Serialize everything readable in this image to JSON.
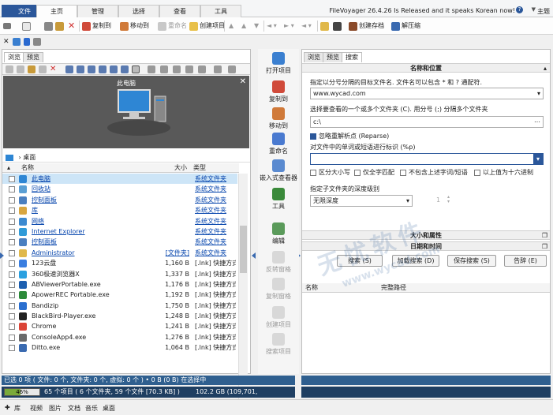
{
  "ribbon": {
    "tabs": [
      "文件",
      "主页",
      "管理",
      "选择",
      "查看",
      "工具"
    ],
    "active_tab": "主页",
    "promo": "FileVoyager 26.4.26 Is Released and it speaks Korean now!",
    "theme": "主题",
    "buttons": {
      "copy_to": "复制到",
      "move_to": "移动到",
      "rename": "重命名",
      "create_item": "创建项目",
      "create_archive": "创建存档",
      "extract": "解压缩"
    }
  },
  "left_pane": {
    "tabs": [
      "浏览",
      "预览"
    ],
    "active_tab": "浏览",
    "preview_title": "此电脑",
    "breadcrumb": "桌面",
    "columns": {
      "name": "名称",
      "size": "大小",
      "type": "类型"
    },
    "rows": [
      {
        "name": "此电脑",
        "size": "",
        "type": "系统文件夹",
        "icon": "computer-icon",
        "color": "#2e86d4",
        "selected": true
      },
      {
        "name": "回收站",
        "size": "",
        "type": "系统文件夹",
        "icon": "recycle-bin-icon",
        "color": "#5a9fd4"
      },
      {
        "name": "控制面板",
        "size": "",
        "type": "系统文件夹",
        "icon": "control-panel-icon",
        "color": "#4a7fc0"
      },
      {
        "name": "库",
        "size": "",
        "type": "系统文件夹",
        "icon": "library-icon",
        "color": "#d8a640"
      },
      {
        "name": "网络",
        "size": "",
        "type": "系统文件夹",
        "icon": "network-icon",
        "color": "#3c8ad0"
      },
      {
        "name": "Internet Explorer",
        "size": "",
        "type": "系统文件夹",
        "icon": "ie-icon",
        "color": "#2f9bd8"
      },
      {
        "name": "控制面板",
        "size": "",
        "type": "系统文件夹",
        "icon": "control-panel-icon",
        "color": "#4a7fc0"
      },
      {
        "name": "Administrator",
        "size": "[文件夹]",
        "type": "系统文件夹",
        "icon": "user-folder-icon",
        "color": "#e0b84a"
      },
      {
        "name": "123云盘",
        "size": "1,160 B",
        "type": "[.lnk] 快捷方式",
        "icon": "cloud-icon",
        "color": "#3a7ee0"
      },
      {
        "name": "360极速浏览器X",
        "size": "1,337 B",
        "type": "[.lnk] 快捷方式",
        "icon": "browser-icon",
        "color": "#2aa0e0"
      },
      {
        "name": "ABViewerPortable.exe",
        "size": "1,176 B",
        "type": "[.lnk] 快捷方式",
        "icon": "app-icon",
        "color": "#1c5fb0"
      },
      {
        "name": "ApowerREC Portable.exe",
        "size": "1,192 B",
        "type": "[.lnk] 快捷方式",
        "icon": "app-icon",
        "color": "#2c8a3a"
      },
      {
        "name": "Bandizip",
        "size": "1,750 B",
        "type": "[.lnk] 快捷方式",
        "icon": "zip-icon",
        "color": "#2a6fd0"
      },
      {
        "name": "BlackBird-Player.exe",
        "size": "1,248 B",
        "type": "[.lnk] 快捷方式",
        "icon": "player-icon",
        "color": "#222222"
      },
      {
        "name": "Chrome",
        "size": "1,241 B",
        "type": "[.lnk] 快捷方式",
        "icon": "chrome-icon",
        "color": "#db4437"
      },
      {
        "name": "ConsoleApp4.exe",
        "size": "1,276 B",
        "type": "[.lnk] 快捷方式",
        "icon": "app-icon",
        "color": "#6a6a6a"
      },
      {
        "name": "Ditto.exe",
        "size": "1,064 B",
        "type": "[.lnk] 快捷方式",
        "icon": "app-icon",
        "color": "#3a6ab0"
      }
    ],
    "footer_tab": "桌面"
  },
  "middle": {
    "items": [
      {
        "label": "打开项目",
        "icon": "open-item-icon",
        "color": "#3a7fd0",
        "enabled": true
      },
      {
        "label": "复制到",
        "icon": "copy-to-icon",
        "color": "#d04a3a",
        "enabled": true
      },
      {
        "label": "移动到",
        "icon": "move-to-icon",
        "color": "#d07a3a",
        "enabled": true
      },
      {
        "label": "重命名",
        "icon": "rename-icon",
        "color": "#4a7ad0",
        "enabled": true
      },
      {
        "label": "嵌入式查看器",
        "icon": "embedded-viewer-icon",
        "color": "#5a8ad0",
        "enabled": true
      },
      {
        "label": "工具",
        "icon": "tools-icon",
        "color": "#3a8a3a",
        "enabled": true
      },
      {
        "label": "编辑",
        "icon": "edit-icon",
        "color": "#5a9a5a",
        "enabled": true
      },
      {
        "label": "反转窗格",
        "icon": "reverse-panes-icon",
        "color": "#999999",
        "enabled": false
      },
      {
        "label": "复制窗格",
        "icon": "copy-pane-icon",
        "color": "#999999",
        "enabled": false
      },
      {
        "label": "创建项目",
        "icon": "create-item-icon",
        "color": "#999999",
        "enabled": false
      },
      {
        "label": "搜索项目",
        "icon": "search-item-icon",
        "color": "#999999",
        "enabled": false
      }
    ]
  },
  "right_pane": {
    "tabs": [
      "浏览",
      "预览",
      "搜索"
    ],
    "active_tab": "搜索",
    "section_name_location": "名称和位置",
    "filename_label": "指定以分号分隔的目标文件名. 文件名可以包含 * 和 ? 通配符.",
    "filename_value": "www.wycad.com",
    "folders_label": "选择要查看的一个或多个文件夹 (C). 用分号 (;) 分隔多个文件夹",
    "folders_value": "c:\\",
    "ignore_reparse": "忽略重解析点 (Reparse)",
    "phrase_label": "对文件中的单词或短语进行标识 (%p)",
    "phrase_value": "",
    "options": [
      "区分大小写",
      "仅全字匹配",
      "不包含上述字词/短语",
      "以上值为十六进制"
    ],
    "depth_label": "指定子文件夹的深度级别",
    "depth_value": "无限深度",
    "depth_number": "1",
    "section_size": "大小和属性",
    "section_date": "日期和时间",
    "buttons": [
      "搜索 (S)",
      "加载搜索 (D)",
      "保存搜索 (S)",
      "告辞 (E)"
    ],
    "results_columns": {
      "name": "名称",
      "path": "完整路径"
    }
  },
  "status": {
    "selection": "已选 0 项 ( 文件: 0 个, 文件夹: 0 个, 虚拟: 0 个 ) • 0 B (0 B) 在选择中",
    "disk_percent_label": "46%",
    "disk_fraction": 0.46,
    "items_summary": "65 个项目 ( 6 个文件夹, 59 个文件 [70.3 KB] )",
    "free_space": "102.2 GB (109,701,"
  },
  "bottom_bar": [
    "库",
    "视频",
    "图片",
    "文档",
    "音乐",
    "桌面"
  ],
  "watermark": {
    "main": "无忧软件",
    "sub": "www.wycad.com"
  }
}
